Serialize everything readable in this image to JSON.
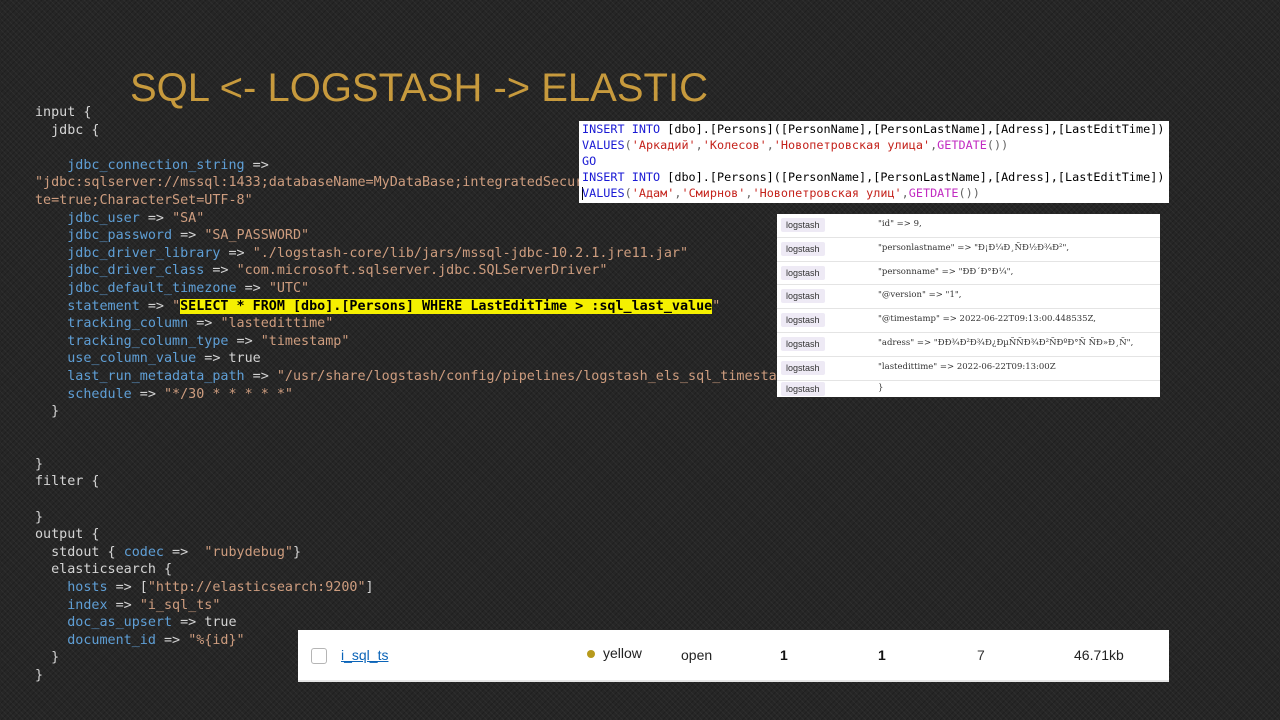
{
  "slide": {
    "title": "SQL <- LOGSTASH -> ELASTIC"
  },
  "colors": {
    "title": "#c79a3d",
    "config_key": "#5f9fd6",
    "config_string": "#ce9d7f",
    "highlight": "#f5f000",
    "health_yellow": "#b79a1c"
  },
  "config": {
    "input_open": "input {",
    "jdbc_open": "  jdbc {",
    "connection_key": "jdbc_connection_string",
    "connection_op": " =>",
    "connection_val_1": "\"jdbc:sqlserver://mssql:1433;databaseName=MyDataBase;integratedSecur",
    "connection_val_2": "te=true;CharacterSet=UTF-8\"",
    "user_key": "jdbc_user",
    "user_val": "\"SA\"",
    "password_key": "jdbc_password",
    "password_val": "\"SA_PASSWORD\"",
    "driver_library_key": "jdbc_driver_library",
    "driver_library_val": "\"./logstash-core/lib/jars/mssql-jdbc-10.2.1.jre11.jar\"",
    "driver_class_key": "jdbc_driver_class",
    "driver_class_val": "\"com.microsoft.sqlserver.jdbc.SQLServerDriver\"",
    "timezone_key": "jdbc_default_timezone",
    "timezone_val": "\"UTC\"",
    "statement_key": "statement",
    "statement_val": "SELECT * FROM [dbo].[Persons] WHERE LastEditTime > :sql_last_value",
    "tracking_column_key": "tracking_column",
    "tracking_column_val": "\"lastedittime\"",
    "tracking_column_type_key": "tracking_column_type",
    "tracking_column_type_val": "\"timestamp\"",
    "use_column_value_key": "use_column_value",
    "use_column_value_val": "true",
    "last_run_key": "last_run_metadata_path",
    "last_run_val": "\"/usr/share/logstash/config/pipelines/logstash_els_sql_timestamp_last_run\"",
    "schedule_key": "schedule",
    "schedule_val": "\"*/30 * * * * *\"",
    "inner_close": "  }",
    "close": "}",
    "filter_open": "filter {",
    "output_open": "output {",
    "stdout_label": "  stdout {",
    "codec_key": "codec",
    "codec_val": "\"rubydebug\"",
    "stdout_close": "}",
    "elasticsearch_open": "  elasticsearch {",
    "hosts_key": "hosts",
    "hosts_val": "\"http://elasticsearch:9200\"",
    "index_key": "index",
    "index_val": "\"i_sql_ts\"",
    "doc_as_upsert_key": "doc_as_upsert",
    "doc_as_upsert_val": "true",
    "document_id_key": "document_id",
    "document_id_val": "\"%{id}\""
  },
  "sql": {
    "insert": "INSERT INTO",
    "table": "[dbo].[Persons]",
    "columns": "([PersonName],[PersonLastName],[Adress],[LastEditTime])",
    "values_kw": "VALUES",
    "row1": [
      "'Аркадий'",
      "'Колесов'",
      "'Новопетровская улица'"
    ],
    "getdate": "GETDATE",
    "go": "GO",
    "row2": [
      "'Адам'",
      "'Смирнов'",
      "'Новопетровская улиц'"
    ]
  },
  "log_output": {
    "tag": "logstash",
    "rows": [
      "\"id\" => 9,",
      "\"personlastname\" => \"Ð¡Ð¼Ð¸ÑÐ½Ð¾Ð²\",",
      "\"personname\" => \"ÐÐ´Ð°Ð¼\",",
      "\"@version\" => \"1\",",
      "\"@timestamp\" => 2022-06-22T09:13:00.448535Z,",
      "\"adress\" => \"ÐÐ¾Ð²Ð¾Ð¿ÐµÑÑÐ¾Ð²ÑÐºÐ°Ñ ÑÐ»Ð¸Ñ\",",
      "\"lastedittime\" => 2022-06-22T09:13:00Z",
      "}"
    ]
  },
  "index_row": {
    "name": "i_sql_ts",
    "health": "yellow",
    "status": "open",
    "primaries": "1",
    "replicas": "1",
    "docs_count": "7",
    "storage_size": "46.71kb"
  }
}
